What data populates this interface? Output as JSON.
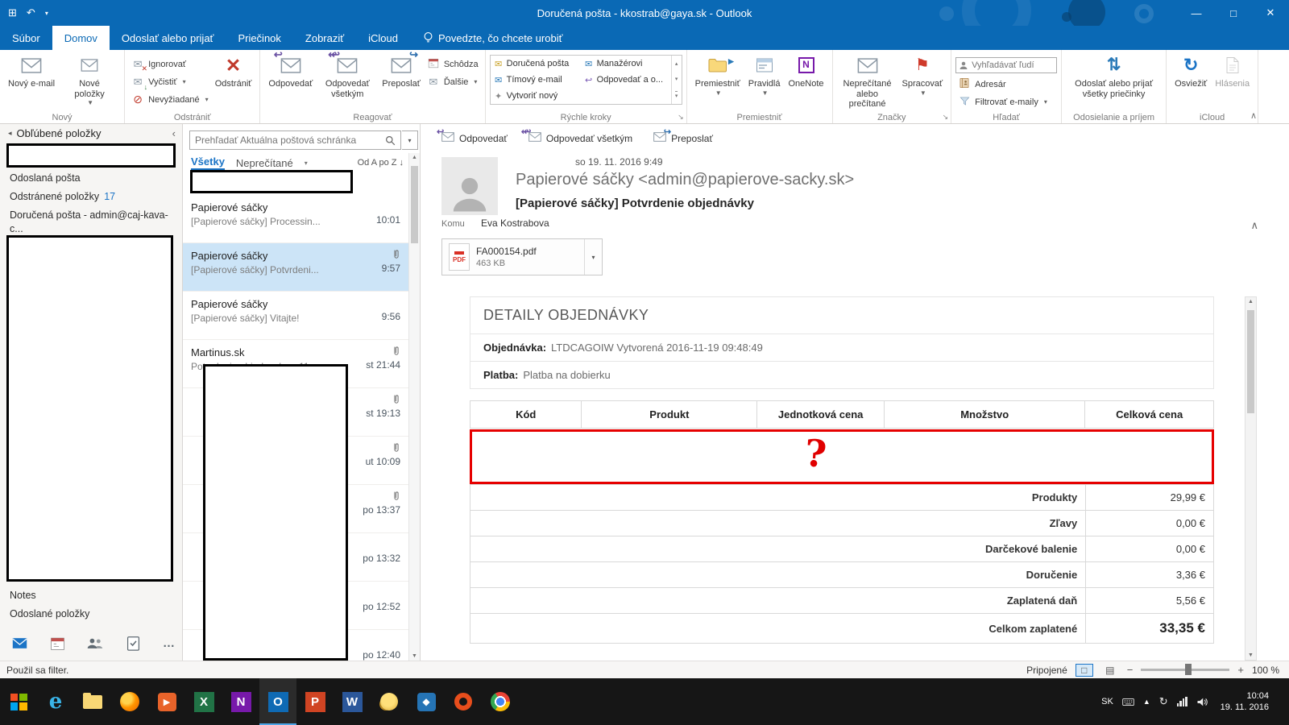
{
  "titlebar": {
    "title": "Doručená pošta - kkostrab@gaya.sk -  Outlook"
  },
  "tabs": {
    "file": "Súbor",
    "home": "Domov",
    "send_receive": "Odoslať alebo prijať",
    "folder": "Priečinok",
    "view": "Zobraziť",
    "icloud": "iCloud",
    "tell_me": "Povedzte, čo chcete urobiť"
  },
  "ribbon": {
    "new_group": {
      "label": "Nový",
      "new_email": "Nový e-mail",
      "new_items": "Nové položky"
    },
    "delete_group": {
      "label": "Odstrániť",
      "ignore": "Ignorovať",
      "cleanup": "Vyčistiť",
      "junk": "Nevyžiadané",
      "delete": "Odstrániť"
    },
    "respond_group": {
      "label": "Reagovať",
      "reply": "Odpovedať",
      "reply_all": "Odpovedať všetkým",
      "forward": "Preposlať",
      "meeting": "Schôdza",
      "more": "Ďalšie"
    },
    "quick_steps": {
      "label": "Rýchle kroky",
      "items": [
        "Doručená pošta",
        "Tímový e-mail",
        "Vytvoriť nový",
        "Manažérovi",
        "Odpovedať a o..."
      ]
    },
    "move_group": {
      "label": "Premiestniť",
      "move": "Premiestniť",
      "rules": "Pravidlá",
      "onenote": "OneNote"
    },
    "tags_group": {
      "label": "Značky",
      "unread": "Neprečítané alebo prečítané",
      "followup": "Spracovať"
    },
    "find_group": {
      "label": "Hľadať",
      "search_people": "Vyhľadávať ľudí",
      "address_book": "Adresár",
      "filter_email": "Filtrovať e-maily"
    },
    "sendreceive_group": {
      "label": "Odosielanie a príjem",
      "line1": "Odoslať alebo prijať",
      "line2": "všetky priečinky"
    },
    "icloud_group": {
      "label": "iCloud",
      "refresh": "Osviežiť",
      "reports": "Hlásenia"
    }
  },
  "folders": {
    "favorites_header": "Obľúbené položky",
    "items": [
      {
        "label": "Odoslaná pošta"
      },
      {
        "label": "Odstránené položky",
        "count": "17"
      },
      {
        "label": "Doručená pošta - admin@caj-kava-c..."
      }
    ],
    "lower_items": [
      {
        "label": "Notes"
      },
      {
        "label": "Odoslané položky"
      }
    ]
  },
  "messages": {
    "search_placeholder": "Prehľadať Aktuálna poštová schránka",
    "tab_all": "Všetky",
    "tab_unread": "Neprečítané",
    "sort": "Od A po Z",
    "items": [
      {
        "sender": "Papierové sáčky",
        "subject": "[Papierové sáčky] Processin...",
        "time": "10:01",
        "has_attachment": false
      },
      {
        "sender": "Papierové sáčky",
        "subject": "[Papierové sáčky] Potvrdeni...",
        "time": "9:57",
        "has_attachment": true,
        "selected": true
      },
      {
        "sender": "Papierové sáčky",
        "subject": "[Papierové sáčky] Vitajte!",
        "time": "9:56",
        "has_attachment": false
      },
      {
        "sender": "Martinus.sk",
        "subject": "Potvrdenie objednavky c.11...",
        "time": "st 21:44",
        "has_attachment": true
      },
      {
        "time": "st 19:13",
        "has_attachment": true
      },
      {
        "time": "ut 10:09",
        "has_attachment": true
      },
      {
        "time": "po 13:37",
        "has_attachment": true
      },
      {
        "time": "po 13:32",
        "has_attachment": false
      },
      {
        "time": "po 12:52",
        "has_attachment": false
      },
      {
        "time": "po 12:40",
        "has_attachment": false
      }
    ]
  },
  "reading": {
    "reply": "Odpovedať",
    "reply_all": "Odpovedať všetkým",
    "forward": "Preposlať",
    "date": "so 19. 11. 2016 9:49",
    "from": "Papierové sáčky <admin@papierove-sacky.sk>",
    "subject": "[Papierové sáčky] Potvrdenie objednávky",
    "to_label": "Komu",
    "to": "Eva Kostrabova",
    "attachment": {
      "name": "FA000154.pdf",
      "size": "463 KB",
      "type": "PDF"
    }
  },
  "email": {
    "heading": "DETAILY OBJEDNÁVKY",
    "order_label": "Objednávka:",
    "order_value": "LTDCAGOIW Vytvorená 2016-11-19 09:48:49",
    "payment_label": "Platba:",
    "payment_value": "Platba na dobierku",
    "table_headers": [
      "Kód",
      "Produkt",
      "Jednotková cena",
      "Množstvo",
      "Celková cena"
    ],
    "annotation_mark": "?",
    "summary": [
      {
        "label": "Produkty",
        "value": "29,99 €"
      },
      {
        "label": "Zľavy",
        "value": "0,00 €"
      },
      {
        "label": "Darčekové balenie",
        "value": "0,00 €"
      },
      {
        "label": "Doručenie",
        "value": "3,36 €"
      },
      {
        "label": "Zaplatená daň",
        "value": "5,56 €"
      },
      {
        "label": "Celkom zaplatené",
        "value": "33,35 €"
      }
    ]
  },
  "statusbar": {
    "filter": "Použil sa filter.",
    "connected": "Pripojené",
    "zoom": "100 %"
  },
  "taskbar": {
    "lang": "SK",
    "time": "10:04",
    "date": "19. 11. 2016"
  },
  "icons": {
    "search-icon": "magnifier",
    "attachment-icon": "paperclip",
    "flag-icon": "red-flag",
    "refresh-icon": "circular-arrow",
    "envelope-icon": "envelope",
    "pdf-icon": "pdf-file",
    "person-icon": "person-silhouette",
    "lightbulb-icon": "bulb"
  }
}
